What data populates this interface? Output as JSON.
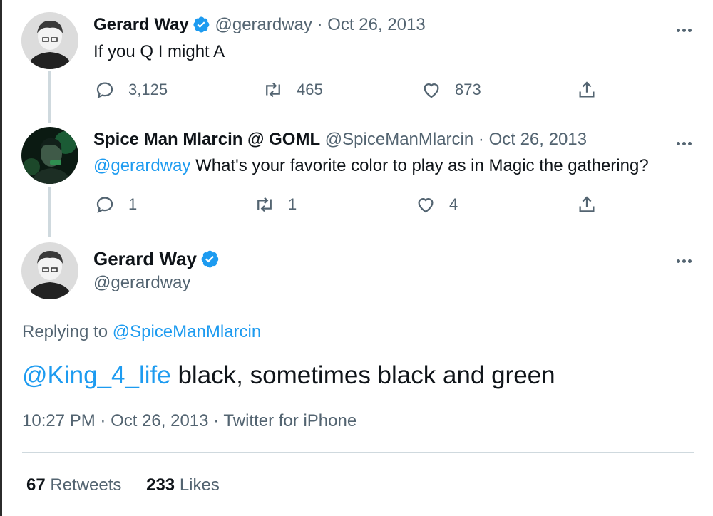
{
  "thread": {
    "tweet1": {
      "name": "Gerard Way",
      "handle": "@gerardway",
      "separator": "·",
      "date": "Oct 26, 2013",
      "text": "If you Q I might A",
      "replies": "3,125",
      "retweets": "465",
      "likes": "873",
      "avatar_icon": "user-photo"
    },
    "tweet2": {
      "name": "Spice Man Mlarcin @ GOML",
      "handle": "@SpiceManMlarcin",
      "separator": "·",
      "date": "Oct 26, 2013",
      "mention": "@gerardway",
      "text": "What's your favorite color to play as in Magic the gathering?",
      "replies": "1",
      "retweets": "1",
      "likes": "4",
      "avatar_icon": "user-photo-green"
    }
  },
  "focused": {
    "name": "Gerard Way",
    "handle": "@gerardway",
    "replying_prefix": "Replying to",
    "replying_to": "@SpiceManMlarcin",
    "mention": "@King_4_life",
    "text": "black, sometimes black and green",
    "time": "10:27 PM",
    "date": "Oct 26, 2013",
    "source": "Twitter for iPhone",
    "separator": "·",
    "retweet_count": "67",
    "retweet_label": "Retweets",
    "like_count": "233",
    "like_label": "Likes"
  },
  "colors": {
    "accent": "#1d9bf0",
    "muted": "#536471",
    "text": "#0f1419",
    "line": "#cfd9de"
  },
  "icons": [
    "verified-badge-icon",
    "reply-icon",
    "retweet-icon",
    "like-icon",
    "share-icon",
    "more-icon"
  ]
}
